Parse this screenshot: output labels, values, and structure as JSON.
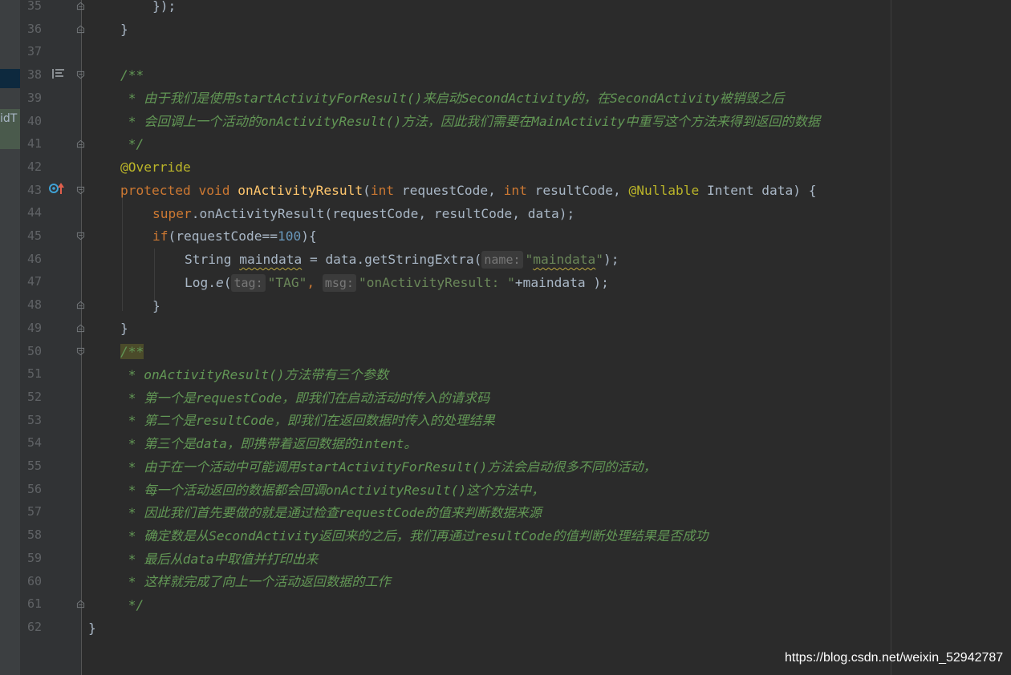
{
  "left_panel": {
    "tab_label": "idT"
  },
  "gutter": {
    "line_numbers": [
      "35",
      "36",
      "37",
      "38",
      "39",
      "40",
      "41",
      "42",
      "43",
      "44",
      "45",
      "46",
      "47",
      "48",
      "49",
      "50",
      "51",
      "52",
      "53",
      "54",
      "55",
      "56",
      "57",
      "58",
      "59",
      "60",
      "61",
      "62"
    ]
  },
  "code": {
    "l35": "});",
    "l36": "}",
    "l38": "/**",
    "l39": " * 由于我们是使用startActivityForResult()来启动SecondActivity的，在SecondActivity被销毁之后",
    "l40": " * 会回调上一个活动的onActivityResult()方法，因此我们需要在MainActivity中重写这个方法来得到返回的数据",
    "l41": " */",
    "l42": "@Override",
    "l43": {
      "protected": "protected",
      "void": "void",
      "method": "onActivityResult",
      "open": "(",
      "int1": "int",
      "p1": " requestCode, ",
      "int2": "int",
      "p2": " resultCode, ",
      "nullable": "@Nullable",
      "p3": " Intent data) {"
    },
    "l44": {
      "super": "super",
      "rest": ".onActivityResult(requestCode, resultCode, data);"
    },
    "l45": {
      "if": "if",
      "a": "(requestCode==",
      "num": "100",
      "b": "){"
    },
    "l46": {
      "a": "String ",
      "var": "maindata",
      "b": " = data.getStringExtra(",
      "hint": "name:",
      "q1": "\"",
      "strword": "maindata",
      "q2": "\"",
      "c": ");"
    },
    "l47": {
      "a": "Log.",
      "e": "e",
      "b": "(",
      "hint1": "tag:",
      "s1": "\"TAG\"",
      "comma": ", ",
      "hint2": "msg:",
      "s2": "\"onActivityResult: \"",
      "c": "+maindata );"
    },
    "l48": "}",
    "l49": "}",
    "l50": "/**",
    "l51": " * onActivityResult()方法带有三个参数",
    "l52": " * 第一个是requestCode，即我们在启动活动时传入的请求码",
    "l53": " * 第二个是resultCode，即我们在返回数据时传入的处理结果",
    "l54": " * 第三个是data，即携带着返回数据的intent。",
    "l55": " * 由于在一个活动中可能调用startActivityForResult()方法会启动很多不同的活动，",
    "l56": " * 每一个活动返回的数据都会回调onActivityResult()这个方法中，",
    "l57": " * 因此我们首先要做的就是通过检查requestCode的值来判断数据来源",
    "l58": " * 确定数是从SecondActivity返回来的之后，我们再通过resultCode的值判断处理结果是否成功",
    "l59": " * 最后从data中取值并打印出来",
    "l60": " * 这样就完成了向上一个活动返回数据的工作",
    "l61": " */",
    "l62": "}"
  },
  "watermark": "https://blog.csdn.net/weixin_52942787",
  "colors": {
    "background": "#2b2b2b",
    "keyword": "#cc7832",
    "method": "#ffc66d",
    "number": "#6897bb",
    "string": "#6a8759",
    "annotation": "#bbb529",
    "doc_comment": "#629755",
    "text": "#a9b7c6"
  }
}
